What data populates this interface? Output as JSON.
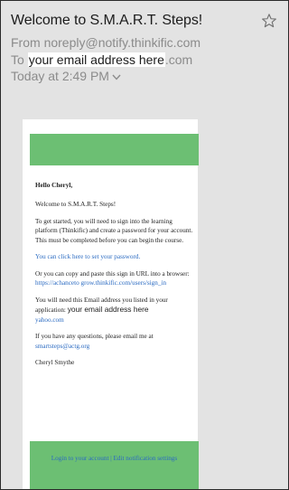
{
  "email": {
    "subject": "Welcome to S.M.A.R.T. Steps!",
    "from_label": "From",
    "from_address": "noreply@notify.thinkific.com",
    "to_label": "To",
    "to_value": "your email address here",
    "to_suffix": ".com",
    "timestamp": "Today at 2:49 PM"
  },
  "message": {
    "greeting": "Hello Cheryl,",
    "welcome": "Welcome to S.M.A.R.T. Steps!",
    "instructions": "To get started, you will need to sign into the learning platform (Thinkific) and create a password for your account. This must be completed before you can begin the course.",
    "password_link": "You can click here to set your password.",
    "copy_paste_intro": "Or you can copy and paste this sign in URL into a browser:",
    "signin_url": "https://achanceto grow.thinkific.com/users/sign_in",
    "email_notice_intro": "You will need this Email address you listed in your application:",
    "email_notice_value": "your email address here",
    "email_notice_domain": "yahoo.com",
    "questions_intro": "If you have any questions, please email me at",
    "contact_email": "smartsteps@actg.org",
    "signature": "Cheryl Smythe"
  },
  "footer": {
    "login_link": "Login to your account",
    "separator": " | ",
    "settings_link": "Edit notification settings"
  },
  "colors": {
    "banner": "#6cbf73",
    "link": "#2b6bc2"
  },
  "icons": {
    "star": "star-icon",
    "chevron": "chevron-down-icon"
  }
}
